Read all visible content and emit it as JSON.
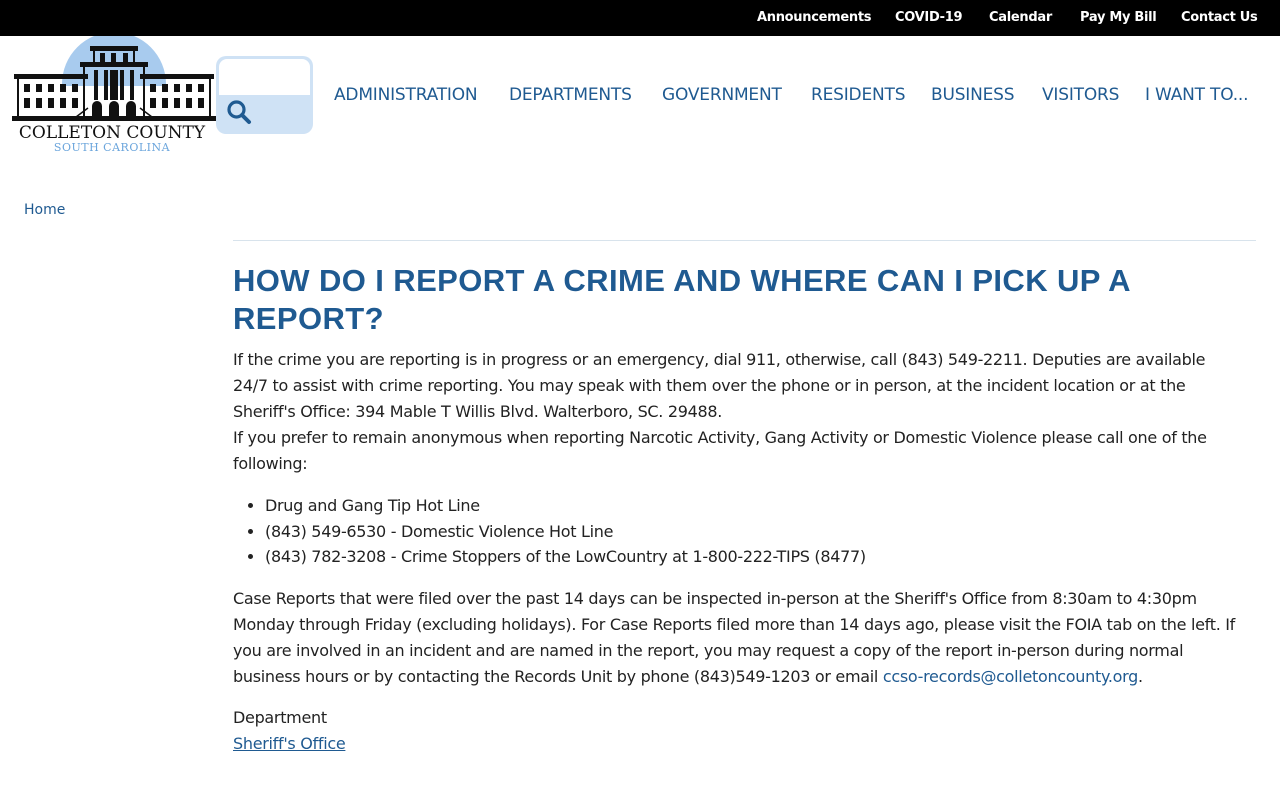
{
  "topbar": {
    "links": [
      "Announcements",
      "COVID-19",
      "Calendar",
      "Pay My Bill",
      "Contact Us"
    ]
  },
  "logo": {
    "name": "COLLETON COUNTY",
    "subtitle": "SOUTH CAROLINA",
    "icon": "courthouse-icon"
  },
  "search": {
    "placeholder": "",
    "value": "",
    "icon": "search-icon"
  },
  "nav": {
    "items": [
      "ADMINISTRATION",
      "DEPARTMENTS",
      "GOVERNMENT",
      "RESIDENTS",
      "BUSINESS",
      "VISITORS",
      "I WANT TO..."
    ]
  },
  "breadcrumb": {
    "home": "Home"
  },
  "main": {
    "title": "HOW DO I REPORT A CRIME AND WHERE CAN I PICK UP A REPORT?",
    "p1_line1": "If the crime you are reporting is in progress or an emergency, dial 911, otherwise, call (843) 549-2211. Deputies are available 24/7 to assist with crime reporting. You may speak with them over the phone or in person, at the incident location or at the",
    "p1_line2": "Sheriff's Office: 394 Mable T Willis Blvd. Walterboro, SC. 29488.",
    "p1_line3": "If you prefer to remain anonymous when reporting Narcotic Activity, Gang Activity or Domestic Violence please call one of the following:",
    "tips": [
      "Drug and Gang Tip Hot Line",
      "(843) 549-6530 - Domestic Violence Hot Line",
      "(843) 782-3208 - Crime Stoppers of the LowCountry at 1-800-222-TIPS (8477)"
    ],
    "p3_text": "Case Reports that were filed over the past 14 days can be inspected in-person at the Sheriff's Office from 8:30am to 4:30pm Monday through Friday (excluding holidays). For Case Reports filed more than 14 days ago, please visit the FOIA tab on the left. If you are involved in an incident and are named in the report, you may request a copy of the report in-person during normal business hours or by contacting the Records Unit by phone (843)549-1203 or email",
    "p3_email": "ccso-records@colletoncounty.org",
    "p3_end": ".",
    "department_label": "Department",
    "department_link": "Sheriff's Office"
  },
  "colors": {
    "brand_blue": "#1f5a91",
    "search_bg": "#cfe2f5",
    "logo_sky": "#a8cbee",
    "topbar_bg": "#000000"
  }
}
